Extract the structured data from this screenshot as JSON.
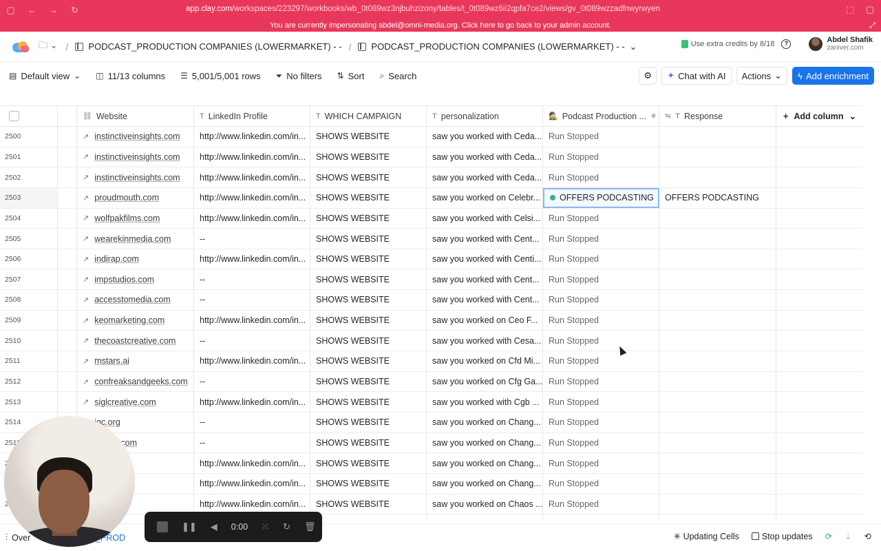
{
  "browser": {
    "url_host": "app.clay.com",
    "url_path": "/workspaces/223297/workbooks/wb_0t089wz3njbuhzizony/tables/t_0t089wz6ii2qpfa7ce2/views/gv_0t089wzzadfnwyrwyen"
  },
  "impersonation": {
    "message": "You are currently impersonating abdel@omni-media.org. Click here to go back to your admin account."
  },
  "header": {
    "breadcrumb_1": "PODCAST_PRODUCTION COMPANIES (LOWERMARKET) - -",
    "breadcrumb_2": "PODCAST_PRODUCTION COMPANIES (LOWERMARKET) - -",
    "credits": "Use extra credits by 8/18",
    "user_name": "Abdel Shafik",
    "user_org": "zaniver.com"
  },
  "toolbar": {
    "view": "Default view",
    "columns": "11/13 columns",
    "rows": "5,001/5,001 rows",
    "filters": "No filters",
    "sort": "Sort",
    "search": "Search",
    "chat": "Chat with AI",
    "actions": "Actions",
    "add_enrichment": "Add enrichment"
  },
  "columns": {
    "website": "Website",
    "linkedin": "LinkedIn Profile",
    "campaign": "WHICH CAMPAIGN",
    "personalization": "personalization",
    "podcast": "Podcast Production ...",
    "response": "Response",
    "add_column": "Add column"
  },
  "rows": [
    {
      "n": "2500",
      "site": "instinctiveinsights.com",
      "li": "http://www.linkedin.com/in...",
      "camp": "SHOWS WEBSITE",
      "pers": "saw you worked with Ceda...",
      "status": "Run Stopped",
      "resp": ""
    },
    {
      "n": "2501",
      "site": "instinctiveinsights.com",
      "li": "http://www.linkedin.com/in...",
      "camp": "SHOWS WEBSITE",
      "pers": "saw you worked with Ceda...",
      "status": "Run Stopped",
      "resp": ""
    },
    {
      "n": "2502",
      "site": "instinctiveinsights.com",
      "li": "http://www.linkedin.com/in...",
      "camp": "SHOWS WEBSITE",
      "pers": "saw you worked with Ceda...",
      "status": "Run Stopped",
      "resp": ""
    },
    {
      "n": "2503",
      "site": "proudmouth.com",
      "li": "http://www.linkedin.com/in...",
      "camp": "SHOWS WEBSITE",
      "pers": "saw you worked on Celebr...",
      "status": "OFFERS PODCASTING",
      "resp": "OFFERS PODCASTING"
    },
    {
      "n": "2504",
      "site": "wolfpakfilms.com",
      "li": "http://www.linkedin.com/in...",
      "camp": "SHOWS WEBSITE",
      "pers": "saw you worked with Celsi...",
      "status": "Run Stopped",
      "resp": ""
    },
    {
      "n": "2505",
      "site": "wearekinmedia.com",
      "li": "--",
      "camp": "SHOWS WEBSITE",
      "pers": "saw you worked with Cent...",
      "status": "Run Stopped",
      "resp": ""
    },
    {
      "n": "2506",
      "site": "indirap.com",
      "li": "http://www.linkedin.com/in...",
      "camp": "SHOWS WEBSITE",
      "pers": "saw you worked with Centi...",
      "status": "Run Stopped",
      "resp": ""
    },
    {
      "n": "2507",
      "site": "impstudios.com",
      "li": "--",
      "camp": "SHOWS WEBSITE",
      "pers": "saw you worked with Cent...",
      "status": "Run Stopped",
      "resp": ""
    },
    {
      "n": "2508",
      "site": "accesstomedia.com",
      "li": "--",
      "camp": "SHOWS WEBSITE",
      "pers": "saw you worked with Cent...",
      "status": "Run Stopped",
      "resp": ""
    },
    {
      "n": "2509",
      "site": "keomarketing.com",
      "li": "http://www.linkedin.com/in...",
      "camp": "SHOWS WEBSITE",
      "pers": "saw you worked on Ceo F...",
      "status": "Run Stopped",
      "resp": ""
    },
    {
      "n": "2510",
      "site": "thecoastcreative.com",
      "li": "--",
      "camp": "SHOWS WEBSITE",
      "pers": "saw you worked with Cesa...",
      "status": "Run Stopped",
      "resp": ""
    },
    {
      "n": "2511",
      "site": "mstars.ai",
      "li": "http://www.linkedin.com/in...",
      "camp": "SHOWS WEBSITE",
      "pers": "saw you worked on Cfd Mi...",
      "status": "Run Stopped",
      "resp": ""
    },
    {
      "n": "2512",
      "site": "confreaksandgeeks.com",
      "li": "--",
      "camp": "SHOWS WEBSITE",
      "pers": "saw you worked on Cfg Ga...",
      "status": "Run Stopped",
      "resp": ""
    },
    {
      "n": "2513",
      "site": "siglcreative.com",
      "li": "http://www.linkedin.com/in...",
      "camp": "SHOWS WEBSITE",
      "pers": "saw you worked with Cgb ...",
      "status": "Run Stopped",
      "resp": ""
    },
    {
      "n": "2514",
      "site": "igc.org",
      "li": "--",
      "camp": "SHOWS WEBSITE",
      "pers": "saw you worked on Chang...",
      "status": "Run Stopped",
      "resp": ""
    },
    {
      "n": "2515",
      "site": "...artin.com",
      "li": "--",
      "camp": "SHOWS WEBSITE",
      "pers": "saw you worked on Chang...",
      "status": "Run Stopped",
      "resp": ""
    },
    {
      "n": "2516",
      "site": "...nt.com",
      "li": "http://www.linkedin.com/in...",
      "camp": "SHOWS WEBSITE",
      "pers": "saw you worked on Chang...",
      "status": "Run Stopped",
      "resp": ""
    },
    {
      "n": "2517",
      "site": "...t.com",
      "li": "http://www.linkedin.com/in...",
      "camp": "SHOWS WEBSITE",
      "pers": "saw you worked on Chang...",
      "status": "Run Stopped",
      "resp": ""
    },
    {
      "n": "2518",
      "site": "...media",
      "li": "http://www.linkedin.com/in...",
      "camp": "SHOWS WEBSITE",
      "pers": "saw you worked on Chaos ...",
      "status": "Run Stopped",
      "resp": ""
    },
    {
      "n": "2519",
      "site": "...d.com",
      "li": "http://www.linkedin.com/in...",
      "camp": "SHOWS WEBSITE",
      "pers": "saw you worked with Charl...",
      "status": "Run Stopped",
      "resp": ""
    }
  ],
  "bottom": {
    "overview": "Over",
    "sheet": "...AST_PROD",
    "updating": "Updating Cells",
    "stop_updates": "Stop updates"
  },
  "recording": {
    "time": "0:00"
  }
}
